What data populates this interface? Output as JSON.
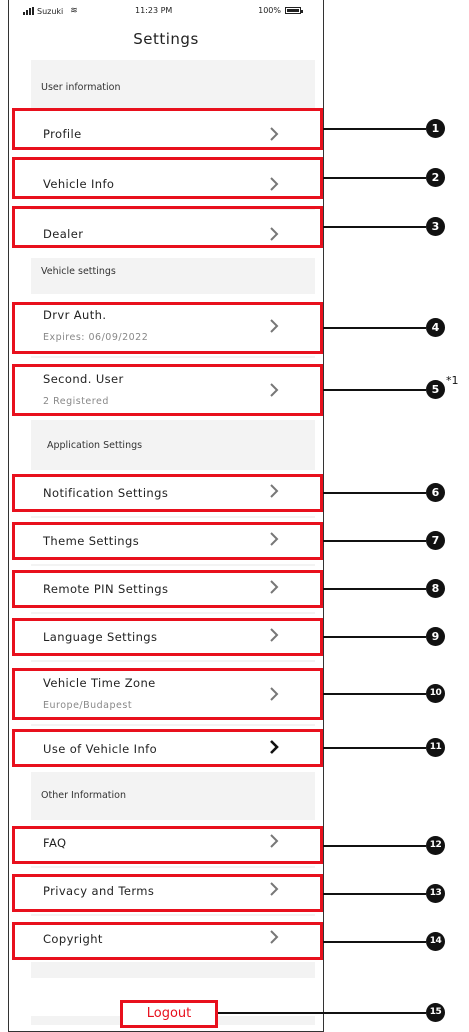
{
  "status_bar": {
    "carrier": "Suzuki",
    "time": "11:23 PM",
    "battery": "100%"
  },
  "title": "Settings",
  "sections": {
    "user_information": "User information",
    "vehicle_settings": "Vehicle settings",
    "application_settings": "Application Settings",
    "other_information": "Other Information"
  },
  "rows": {
    "profile": {
      "label": "Profile"
    },
    "vehicle_info": {
      "label": "Vehicle Info"
    },
    "dealer": {
      "label": "Dealer"
    },
    "drvr_auth": {
      "label": "Drvr Auth.",
      "sub": "Expires: 06/09/2022"
    },
    "second_user": {
      "label": "Second. User",
      "sub": "2 Registered"
    },
    "notification": {
      "label": "Notification Settings"
    },
    "theme": {
      "label": "Theme Settings"
    },
    "remote_pin": {
      "label": "Remote PIN Settings"
    },
    "language": {
      "label": "Language Settings"
    },
    "time_zone": {
      "label": "Vehicle Time Zone",
      "sub": "Europe/Budapest"
    },
    "use_of_vehicle_info": {
      "label": "Use of Vehicle Info"
    },
    "faq": {
      "label": "FAQ"
    },
    "privacy": {
      "label": "Privacy and Terms"
    },
    "copyright": {
      "label": "Copyright"
    }
  },
  "logout_label": "Logout",
  "callouts": [
    "1",
    "2",
    "3",
    "4",
    "5",
    "6",
    "7",
    "8",
    "9",
    "10",
    "11",
    "12",
    "13",
    "14",
    "15"
  ],
  "footnote_mark": "*1",
  "colors": {
    "highlight": "#e8101d",
    "background": "#f3f3f3",
    "badge": "#111111"
  }
}
